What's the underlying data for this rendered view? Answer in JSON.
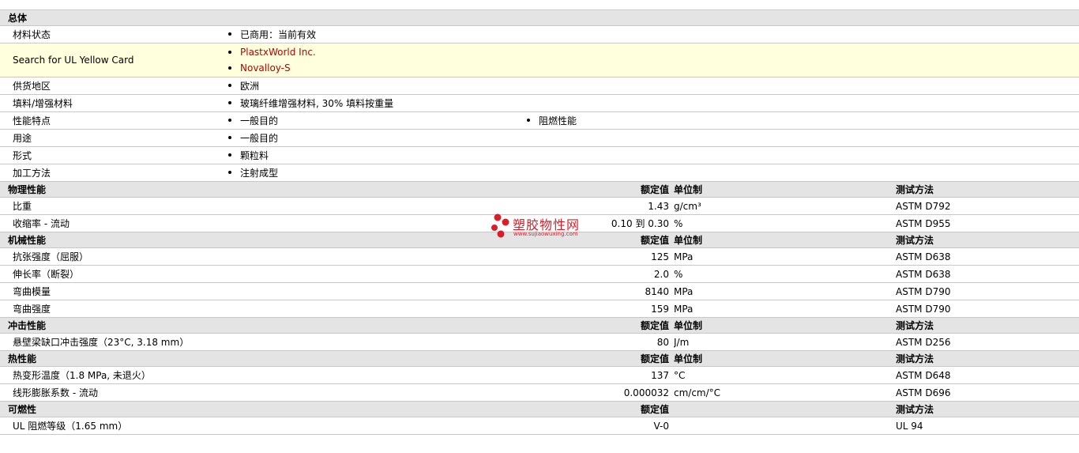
{
  "general": {
    "title": "总体",
    "rows": [
      {
        "label": "材料状态",
        "values": [
          "已商用：当前有效"
        ]
      },
      {
        "label": "Search for UL Yellow Card",
        "links": [
          "PlastxWorld Inc.",
          "Novalloy-S"
        ]
      },
      {
        "label": "供货地区",
        "values": [
          "欧洲"
        ]
      },
      {
        "label": "填料/增强材料",
        "values": [
          "玻璃纤维增强材料, 30% 填料按重量"
        ]
      },
      {
        "label": "性能特点",
        "values": [
          "一般目的",
          "阻燃性能"
        ]
      },
      {
        "label": "用途",
        "values": [
          "一般目的"
        ]
      },
      {
        "label": "形式",
        "values": [
          "颗粒料"
        ]
      },
      {
        "label": "加工方法",
        "values": [
          "注射成型"
        ]
      }
    ]
  },
  "sections": [
    {
      "title": "物理性能",
      "col_value": "额定值",
      "col_unit": "单位制",
      "col_method": "测试方法",
      "rows": [
        {
          "label": "比重",
          "value": "1.43",
          "unit": "g/cm³",
          "method": "ASTM D792"
        },
        {
          "label": "收缩率  - 流动",
          "value": "0.10 到  0.30",
          "unit": "%",
          "method": "ASTM D955"
        }
      ]
    },
    {
      "title": "机械性能",
      "col_value": "额定值",
      "col_unit": "单位制",
      "col_method": "测试方法",
      "rows": [
        {
          "label": "抗张强度（屈服）",
          "value": "125",
          "unit": "MPa",
          "method": "ASTM D638"
        },
        {
          "label": "伸长率（断裂）",
          "value": "2.0",
          "unit": "%",
          "method": "ASTM D638"
        },
        {
          "label": "弯曲模量",
          "value": "8140",
          "unit": "MPa",
          "method": "ASTM D790"
        },
        {
          "label": "弯曲强度",
          "value": "159",
          "unit": "MPa",
          "method": "ASTM D790"
        }
      ]
    },
    {
      "title": "冲击性能",
      "col_value": "额定值",
      "col_unit": "单位制",
      "col_method": "测试方法",
      "rows": [
        {
          "label": "悬壁梁缺口冲击强度（23°C, 3.18 mm）",
          "value": "80",
          "unit": "J/m",
          "method": "ASTM D256"
        }
      ]
    },
    {
      "title": "热性能",
      "col_value": "额定值",
      "col_unit": "单位制",
      "col_method": "测试方法",
      "rows": [
        {
          "label": "热变形温度（1.8 MPa, 未退火）",
          "value": "137",
          "unit": "°C",
          "method": "ASTM D648"
        },
        {
          "label": "线形膨胀系数  - 流动",
          "value": "0.000032",
          "unit": "cm/cm/°C",
          "method": "ASTM D696"
        }
      ]
    },
    {
      "title": "可燃性",
      "col_value": "额定值",
      "col_unit": "",
      "col_method": "测试方法",
      "rows": [
        {
          "label": "UL 阻燃等级（1.65 mm）",
          "value": "V-0",
          "unit": "",
          "method": "UL 94"
        }
      ]
    }
  ],
  "watermark": {
    "cn": "塑胶物性网",
    "en": "www.sujiaowuxing.com",
    "color": "#d91e2a"
  }
}
